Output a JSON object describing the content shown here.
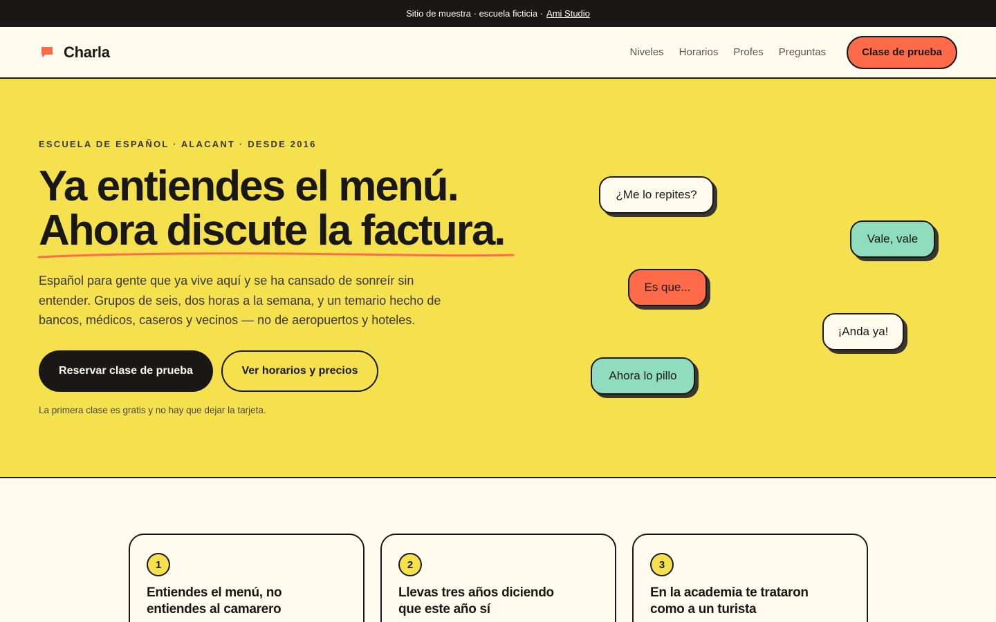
{
  "banner": {
    "text": "Sitio de muestra · escuela ficticia ·",
    "link": "Ami Studio"
  },
  "header": {
    "brand": "Charla",
    "nav": [
      "Niveles",
      "Horarios",
      "Profes",
      "Preguntas"
    ],
    "cta": "Clase de prueba"
  },
  "hero": {
    "eyebrow": "ESCUELA DE ESPAÑOL · ALACANT · DESDE 2016",
    "headline_1": "Ya entiendes el menú.",
    "headline_2": "Ahora discute la factura.",
    "lead": "Español para gente que ya vive aquí y se ha cansado de sonreír sin entender. Grupos de seis, dos horas a la semana, y un temario hecho de bancos, médicos, caseros y vecinos — no de aeropuertos y hoteles.",
    "primary_button": "Reservar clase de prueba",
    "secondary_button": "Ver horarios y precios",
    "note": "La primera clase es gratis y no hay que dejar la tarjeta.",
    "bubbles": [
      "¿Me lo repites?",
      "Vale, vale",
      "Es que...",
      "¡Anda ya!",
      "Ahora lo pillo"
    ]
  },
  "steps": [
    {
      "number": "1",
      "title": "Entiendes el menú, no entiendes al camarero"
    },
    {
      "number": "2",
      "title": "Llevas tres años diciendo que este año sí"
    },
    {
      "number": "3",
      "title": "En la academia te trataron como a un turista"
    }
  ],
  "colors": {
    "ink": "#1a1816",
    "cream": "#fffbee",
    "yellow": "#f4e14d",
    "coral": "#ff6a48",
    "mint": "#8fdcbf"
  }
}
